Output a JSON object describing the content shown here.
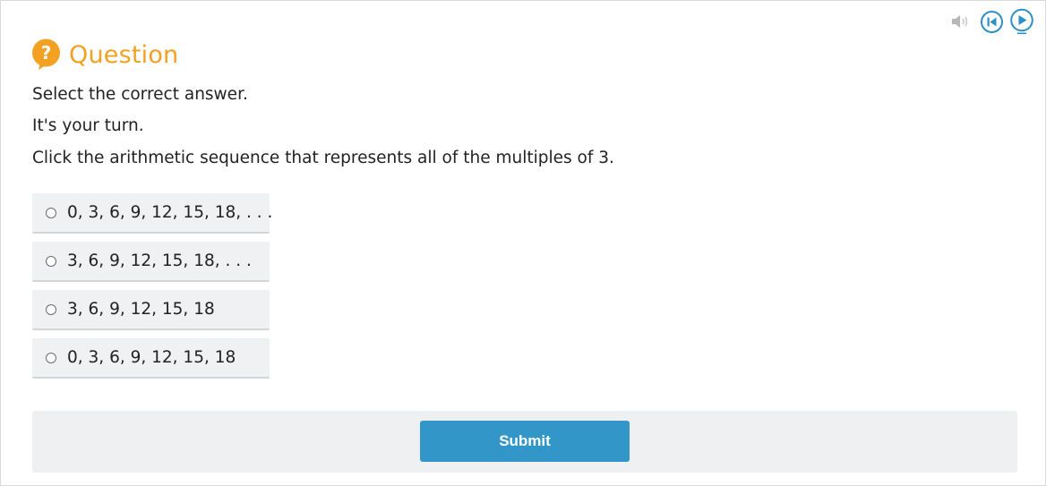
{
  "media": {
    "icons": [
      "speaker-icon",
      "rewind-icon",
      "play-icon"
    ],
    "accent_color": "#2f8fc6",
    "muted_color": "#b7b7b7"
  },
  "header": {
    "icon": "question-badge-icon",
    "badge_symbol": "?",
    "title": "Question",
    "title_color": "#f2a122"
  },
  "prompt": {
    "instruction": "Select the correct answer.",
    "turn": "It's your turn.",
    "question": "Click the arithmetic sequence that represents all of the multiples of 3."
  },
  "options": [
    {
      "label": "0, 3, 6, 9, 12, 15, 18, . . .",
      "selected": false
    },
    {
      "label": "3, 6, 9, 12, 15, 18, . . .",
      "selected": false
    },
    {
      "label": "3, 6, 9, 12, 15, 18",
      "selected": false
    },
    {
      "label": "0, 3, 6, 9, 12, 15, 18",
      "selected": false
    }
  ],
  "submit": {
    "label": "Submit",
    "color": "#3396c9"
  }
}
